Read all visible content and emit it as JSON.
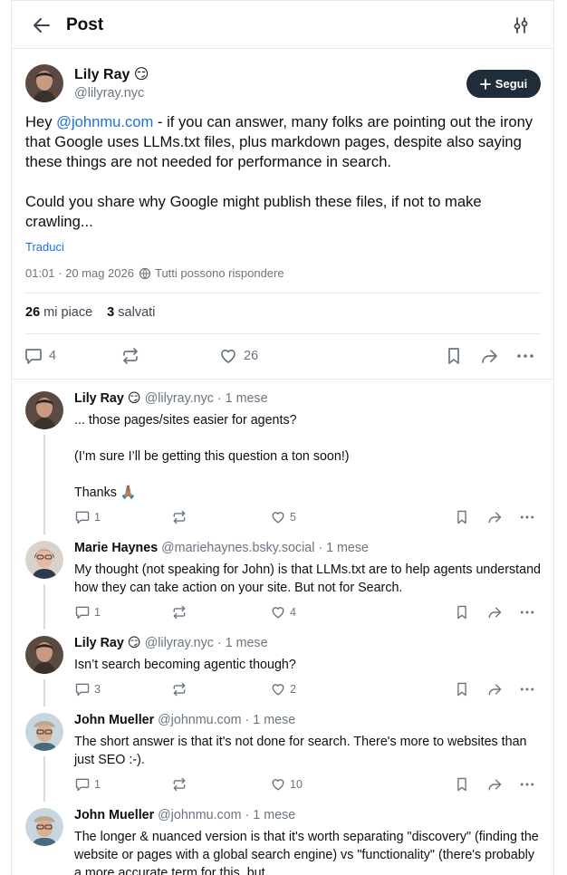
{
  "header": {
    "title": "Post"
  },
  "post": {
    "author_name": "Lily Ray 😏",
    "author_handle": "@lilyray.nyc",
    "follow_label": "Segui",
    "text_prefix": "Hey ",
    "mention": "@johnmu.com",
    "text_rest": " - if you can answer, many folks are pointing out the irony that Google uses LLMs.txt files, plus markdown pages, despite also saying these things are not needed for performance in search.\n\nCould you share why Google might publish these files, if not to make crawling...",
    "translate_label": "Traduci",
    "timestamp": "01:01 · 20 mag 2026",
    "reply_setting": "Tutti possono rispondere",
    "likes_count": "26",
    "likes_label": "mi piace",
    "saves_count": "3",
    "saves_label": "salvati",
    "reply_count": "4",
    "like_count": "26"
  },
  "replies": [
    {
      "name": "Lily Ray 😏",
      "handle": "@lilyray.nyc",
      "time": "· 1 mese",
      "text": "... those pages/sites easier for agents?\n\n(I’m sure I’ll be getting this question a ton soon!)\n\nThanks 🙏🏽",
      "reply_count": "1",
      "like_count": "5"
    },
    {
      "name": "Marie Haynes",
      "handle": "@mariehaynes.bsky.social",
      "time": "· 1 mese",
      "text": "My thought (not speaking for John) is that LLMs.txt are to help agents understand how they can take action on your site. But not for Search.",
      "reply_count": "1",
      "like_count": "4"
    },
    {
      "name": "Lily Ray 😏",
      "handle": "@lilyray.nyc",
      "time": "· 1 mese",
      "text": "Isn’t search becoming agentic though?",
      "reply_count": "3",
      "like_count": "2"
    },
    {
      "name": "John Mueller",
      "handle": "@johnmu.com",
      "time": "· 1 mese",
      "text": "The short answer is that it's not done for search. There's more to websites than just SEO :-).",
      "reply_count": "1",
      "like_count": "10"
    },
    {
      "name": "John Mueller",
      "handle": "@johnmu.com",
      "time": "· 1 mese",
      "text": "The longer & nuanced version is that it's worth separating \"discovery\" (finding the website or pages with a global search engine) vs \"functionality\" (there's probably a more accurate term for this, but",
      "reply_count": "",
      "like_count": ""
    }
  ],
  "colors": {
    "accent": "#1d72d8",
    "follow_bg": "#1f2c3a",
    "muted": "#6b7580",
    "border": "#e6e8eb"
  },
  "icons": [
    "back-arrow-icon",
    "filter-sliders-icon",
    "plus-icon",
    "globe-reply-icon",
    "reply-icon",
    "repost-icon",
    "heart-icon",
    "bookmark-icon",
    "share-icon",
    "more-icon"
  ]
}
